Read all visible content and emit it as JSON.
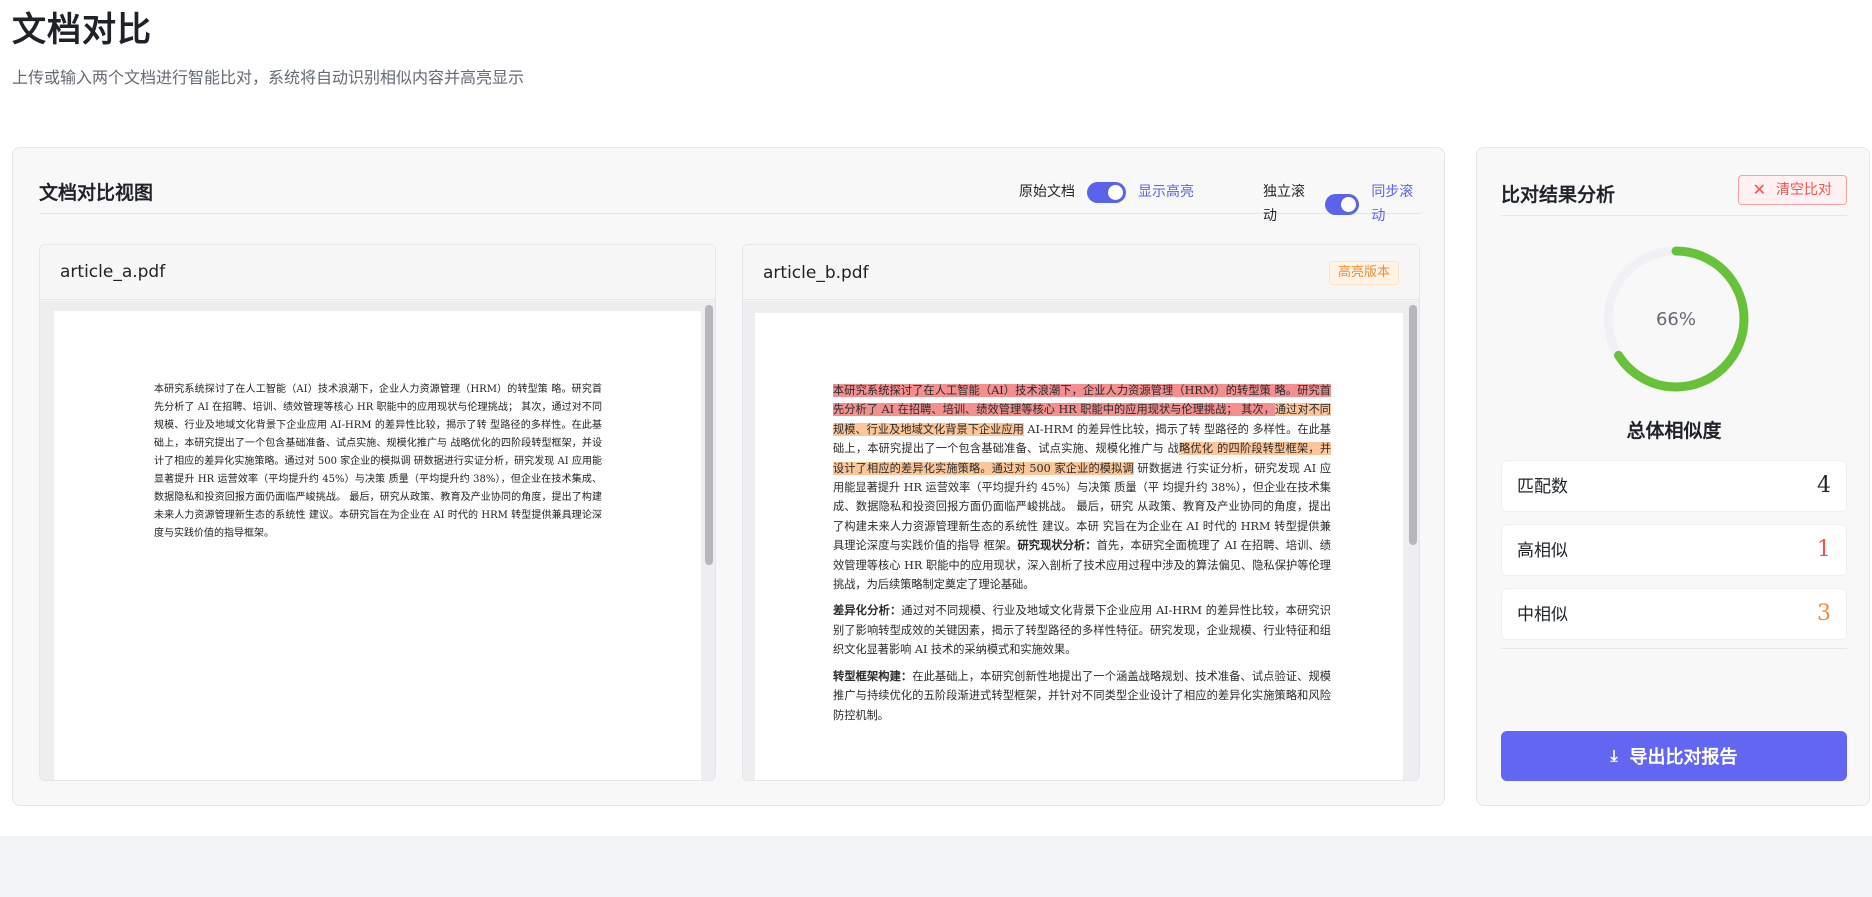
{
  "header": {
    "title": "文档对比",
    "subtitle": "上传或输入两个文档进行智能比对，系统将自动识别相似内容并高亮显示"
  },
  "compare_view": {
    "title": "文档对比视图",
    "toggle_original": {
      "off_label": "原始文档",
      "on_label": "显示高亮",
      "on": true
    },
    "toggle_scroll": {
      "off_label": "独立滚动",
      "on_label": "同步滚动",
      "on": true
    }
  },
  "doc_a": {
    "filename": "article_a.pdf",
    "text": "本研究系统探讨了在人工智能（AI）技术浪潮下，企业人力资源管理（HRM）的转型策 略。研究首先分析了 AI 在招聘、培训、绩效管理等核心 HR 职能中的应用现状与伦理挑战； 其次，通过对不同规模、行业及地域文化背景下企业应用 AI-HRM 的差异性比较，揭示了转 型路径的多样性。在此基础上，本研究提出了一个包含基础准备、试点实施、规模化推广与 战略优化的四阶段转型框架，并设计了相应的差异化实施策略。通过对 500 家企业的模拟调 研数据进行实证分析，研究发现 AI 应用能显著提升 HR 运营效率（平均提升约 45%）与决策 质量（平均提升约 38%），但企业在技术集成、数据隐私和投资回报方面仍面临严峻挑战。 最后，研究从政策、教育及产业协同的角度，提出了构建未来人力资源管理新生态的系统性 建议。本研究旨在为企业在 AI 时代的 HRM 转型提供兼具理论深度与实践价值的指导框架。"
  },
  "doc_b": {
    "filename": "article_b.pdf",
    "badge": "高亮版本",
    "p1_hl1": "本研究系统探讨了在人工智能（AI）技术浪潮下，企业人力资源管理（HRM）的转型策 略。研究首先分析了 AI 在招聘、培训、绩效管理等核心 HR 职能中的应用现状与伦理挑战； 其次，",
    "p1_hl2": "通过对不同规模、行业及地域文化背景下企业应用",
    "p1_plain1": " AI-HRM 的差异性比较，揭示了转 型路径的 多样性。在此基础上，本研究提出了一个包含基础准备、试点实施、规模化推广与 战",
    "p1_hl3": "略优化 的四阶段转型框架，并设计了相应的差异化实施策略。通过对 500 家企业的模拟调",
    "p1_plain2": " 研数据进 行实证分析，研究发现 AI 应用能显著提升 HR 运营效率（平均提升约 45%）与决策 质量（平 均提升约 38%），但企业在技术集成、数据隐私和投资回报方面仍面临严峻挑战。 最后，研究 从政策、教育及产业协同的角度，提出了构建未来人力资源管理新生态的系统性 建议。本研 究旨在为企业在 AI 时代的 HRM 转型提供兼具理论深度与实践价值的指导 框架。",
    "p1_bold": "研究现状分析：",
    "p1_tail": "首先，本研究全面梳理了 AI 在招聘、培训、绩效管理等核心 HR 职能中的应用现状，深入剖析了技术应用过程中涉及的算法偏见、隐私保护等伦理挑战，为后续策略制定奠定了理论基础。",
    "p2_bold": "差异化分析：",
    "p2_text": "通过对不同规模、行业及地域文化背景下企业应用 AI-HRM 的差异性比较，本研究识别了影响转型成效的关键因素，揭示了转型路径的多样性特征。研究发现，企业规模、行业特征和组织文化显著影响 AI 技术的采纳模式和实施效果。",
    "p3_bold": "转型框架构建：",
    "p3_text": "在此基础上，本研究创新性地提出了一个涵盖战略规划、技术准备、试点验证、规模推广与持续优化的五阶段渐进式转型框架，并针对不同类型企业设计了相应的差异化实施策略和风险防控机制。"
  },
  "results": {
    "title": "比对结果分析",
    "clear_label": "清空比对",
    "similarity_percent": 66,
    "similarity_text": "66%",
    "similarity_label": "总体相似度",
    "stats": [
      {
        "label": "匹配数",
        "value": "4",
        "color": "#1f2329"
      },
      {
        "label": "高相似",
        "value": "1",
        "color": "#e85555"
      },
      {
        "label": "中相似",
        "value": "3",
        "color": "#f08c3c"
      }
    ],
    "export_label": "导出比对报告"
  },
  "colors": {
    "accent": "#6366f1",
    "gauge": "#67c23a",
    "gauge_track": "#f0f1f5",
    "highlight_high": "#f38f8f",
    "highlight_medium": "#fbc69a"
  }
}
